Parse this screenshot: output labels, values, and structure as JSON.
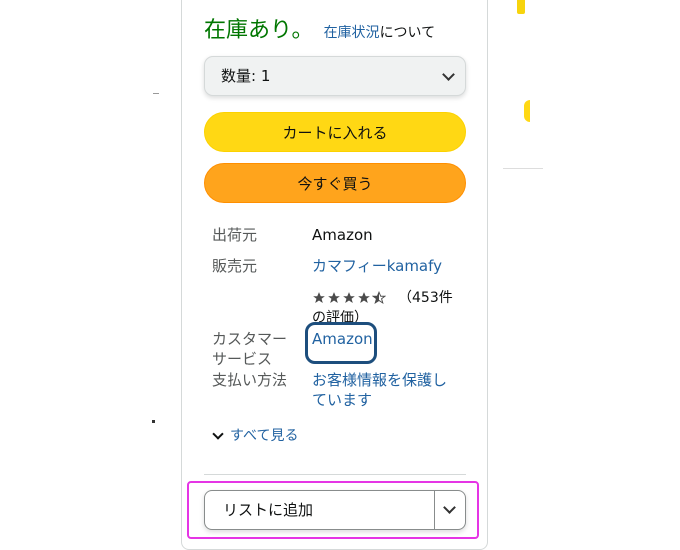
{
  "availability": {
    "status": "在庫あり。",
    "link": "在庫状況",
    "suffix": "について"
  },
  "quantity": {
    "label": "数量: 1"
  },
  "buttons": {
    "add_to_cart": "カートに入れる",
    "buy_now": "今すぐ買う"
  },
  "details": {
    "ships_from_label": "出荷元",
    "ships_from_value": "Amazon",
    "sold_by_label": "販売元",
    "sold_by_value": "カマフィーkamafy",
    "rating_stars": 4.5,
    "rating_count_line1": "（453件",
    "rating_count_line2": "の評価）",
    "customer_service_label_1": "カスタマー",
    "customer_service_label_2": "サービス",
    "customer_service_value": "Amazon",
    "payment_label": "支払い方法",
    "payment_value_1": "お客様情報を保護し",
    "payment_value_2": "ています"
  },
  "see_all": "すべて見る",
  "add_to_list": {
    "label": "リストに追加"
  },
  "colors": {
    "in_stock": "#007600",
    "link": "#2162a1",
    "cart_button": "#ffd814",
    "buy_button": "#ffa41c",
    "star": "#4b4b4b",
    "highlight_blue": "#1d4e7d",
    "highlight_magenta": "#e535e5"
  }
}
